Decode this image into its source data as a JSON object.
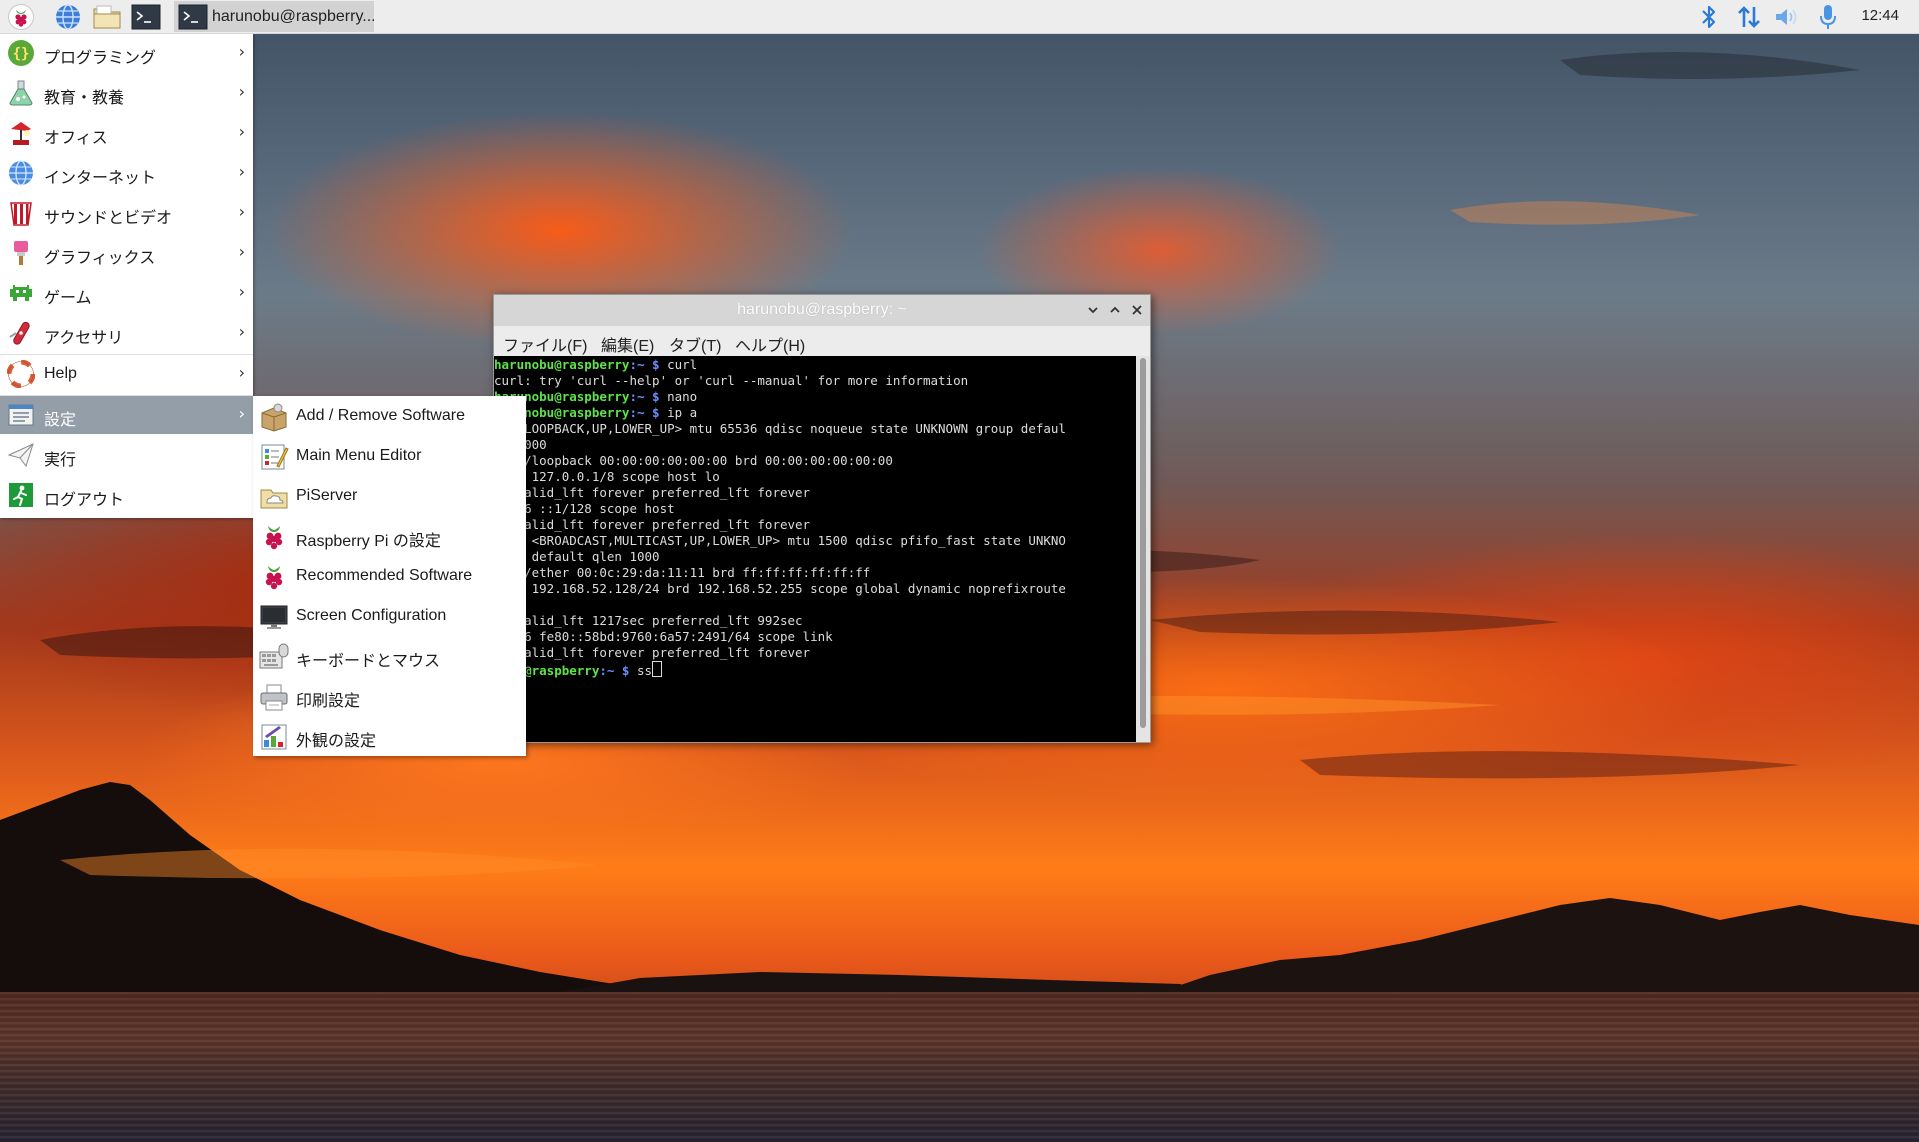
{
  "taskbar": {
    "launchers": [
      {
        "icon": "raspberry-menu-icon"
      },
      {
        "icon": "web-browser-icon"
      },
      {
        "icon": "file-manager-icon"
      },
      {
        "icon": "terminal-icon"
      }
    ],
    "task": {
      "icon": "terminal-icon",
      "label": "harunobu@raspberry..."
    },
    "tray": [
      "bluetooth-icon",
      "network-icon",
      "volume-icon",
      "microphone-icon"
    ],
    "clock": "12:44"
  },
  "menu": {
    "items": [
      {
        "label": "プログラミング",
        "icon": "programming-icon",
        "has_submenu": true
      },
      {
        "label": "教育・教養",
        "icon": "education-icon",
        "has_submenu": true
      },
      {
        "label": "オフィス",
        "icon": "office-icon",
        "has_submenu": true
      },
      {
        "label": "インターネット",
        "icon": "internet-icon",
        "has_submenu": true
      },
      {
        "label": "サウンドとビデオ",
        "icon": "sound-video-icon",
        "has_submenu": true
      },
      {
        "label": "グラフィックス",
        "icon": "graphics-icon",
        "has_submenu": true
      },
      {
        "label": "ゲーム",
        "icon": "games-icon",
        "has_submenu": true
      },
      {
        "label": "アクセサリ",
        "icon": "accessories-icon",
        "has_submenu": true
      },
      {
        "label": "Help",
        "icon": "help-icon",
        "has_submenu": true
      },
      {
        "label": "設定",
        "icon": "preferences-icon",
        "has_submenu": true,
        "active": true
      },
      {
        "label": "実行",
        "icon": "run-icon",
        "has_submenu": false
      },
      {
        "label": "ログアウト",
        "icon": "logout-icon",
        "has_submenu": false
      }
    ],
    "chevron": "›"
  },
  "submenu": {
    "items": [
      {
        "label": "Add / Remove Software",
        "icon": "package-icon"
      },
      {
        "label": "Main Menu Editor",
        "icon": "menu-editor-icon"
      },
      {
        "label": "PiServer",
        "icon": "piserver-icon"
      },
      {
        "label": "Raspberry Pi の設定",
        "icon": "raspberry-icon"
      },
      {
        "label": "Recommended Software",
        "icon": "raspberry-icon"
      },
      {
        "label": "Screen Configuration",
        "icon": "monitor-icon"
      },
      {
        "label": "キーボードとマウス",
        "icon": "keyboard-mouse-icon"
      },
      {
        "label": "印刷設定",
        "icon": "printer-icon"
      },
      {
        "label": "外観の設定",
        "icon": "appearance-icon"
      }
    ]
  },
  "terminal": {
    "title": "harunobu@raspberry: ~",
    "menubar": [
      "ファイル(F)",
      "編集(E)",
      "タブ(T)",
      "ヘルプ(H)"
    ],
    "prompt_user": "harunobu@raspberry",
    "prompt_path": ":~ $",
    "lines": [
      {
        "type": "prompt",
        "user": "harunobu@raspberry",
        "path": ":~ $",
        "cmd": " curl"
      },
      {
        "type": "out",
        "text": "curl: try 'curl --help' or 'curl --manual' for more information"
      },
      {
        "type": "prompt",
        "user": "harunobu@raspberry",
        "path": ":~ $",
        "cmd": " nano"
      },
      {
        "type": "prompt",
        "user": "harunobu@raspberry",
        "path": ":~ $",
        "cmd": " ip a"
      },
      {
        "type": "out",
        "text": "o: <LOOPBACK,UP,LOWER_UP> mtu 65536 qdisc noqueue state UNKNOWN group defaul"
      },
      {
        "type": "out",
        "text": "en 1000"
      },
      {
        "type": "out",
        "text": "link/loopback 00:00:00:00:00:00 brd 00:00:00:00:00:00"
      },
      {
        "type": "out",
        "text": "inet 127.0.0.1/8 scope host lo"
      },
      {
        "type": "out",
        "text": "   valid_lft forever preferred_lft forever"
      },
      {
        "type": "out",
        "text": "inet6 ::1/128 scope host"
      },
      {
        "type": "out",
        "text": "   valid_lft forever preferred_lft forever"
      },
      {
        "type": "out",
        "text": "th0: <BROADCAST,MULTICAST,UP,LOWER_UP> mtu 1500 qdisc pfifo_fast state UNKNO"
      },
      {
        "type": "out",
        "text": "roup default qlen 1000"
      },
      {
        "type": "out",
        "text": "link/ether 00:0c:29:da:11:11 brd ff:ff:ff:ff:ff:ff"
      },
      {
        "type": "out",
        "text": "inet 192.168.52.128/24 brd 192.168.52.255 scope global dynamic noprefixroute"
      },
      {
        "type": "out",
        "text": "0"
      },
      {
        "type": "out",
        "text": "   valid_lft 1217sec preferred_lft 992sec"
      },
      {
        "type": "out",
        "text": "inet6 fe80::58bd:9760:6a57:2491/64 scope link"
      },
      {
        "type": "out",
        "text": "   valid_lft forever preferred_lft forever"
      },
      {
        "type": "prompt",
        "user": "nobu@raspberry",
        "path": ":~ $",
        "cmd": " ss"
      }
    ]
  },
  "colors": {
    "terminal_bg": "#000000",
    "prompt_user": "#5ee34a",
    "prompt_path": "#6a8fff",
    "menu_active": "#939ea8",
    "taskbar_bg": "#ededed"
  }
}
